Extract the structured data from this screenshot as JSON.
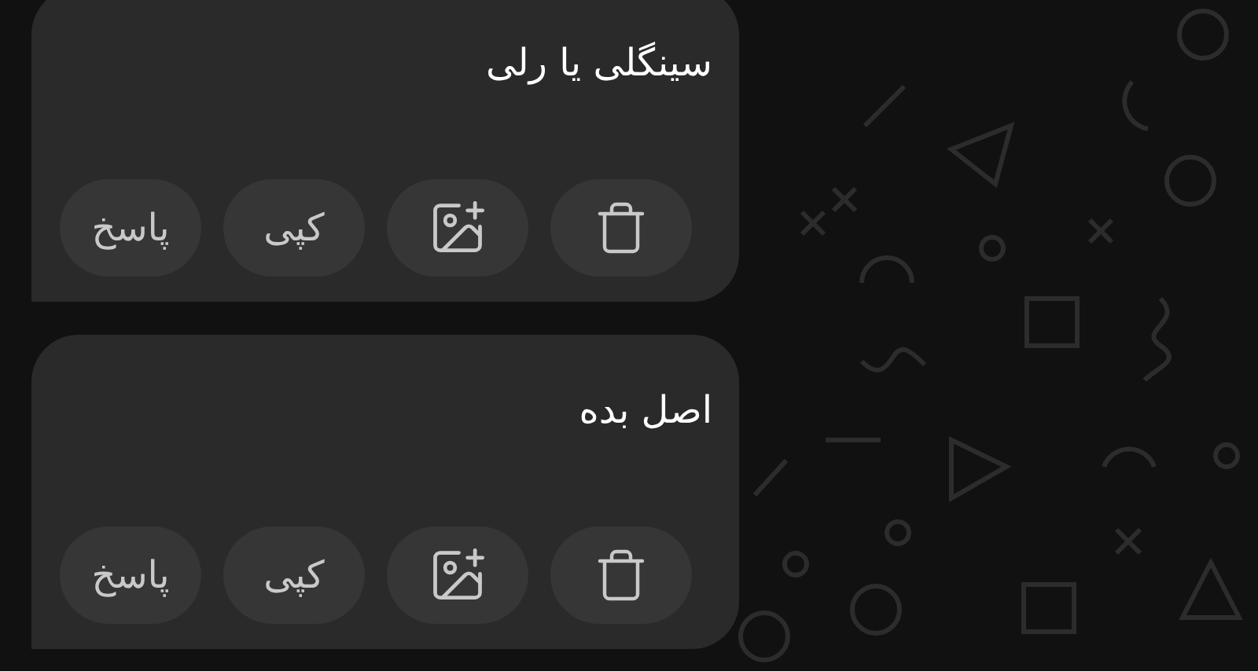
{
  "messages": [
    {
      "text": "سینگلی یا رلی",
      "actions": [
        {
          "kind": "delete"
        },
        {
          "kind": "add_image"
        },
        {
          "kind": "text",
          "label": "کپی"
        },
        {
          "kind": "text",
          "label": "پاسخ"
        }
      ]
    },
    {
      "text": "اصل بده",
      "actions": [
        {
          "kind": "delete"
        },
        {
          "kind": "add_image"
        },
        {
          "kind": "text",
          "label": "کپی"
        },
        {
          "kind": "text",
          "label": "پاسخ"
        }
      ]
    }
  ]
}
